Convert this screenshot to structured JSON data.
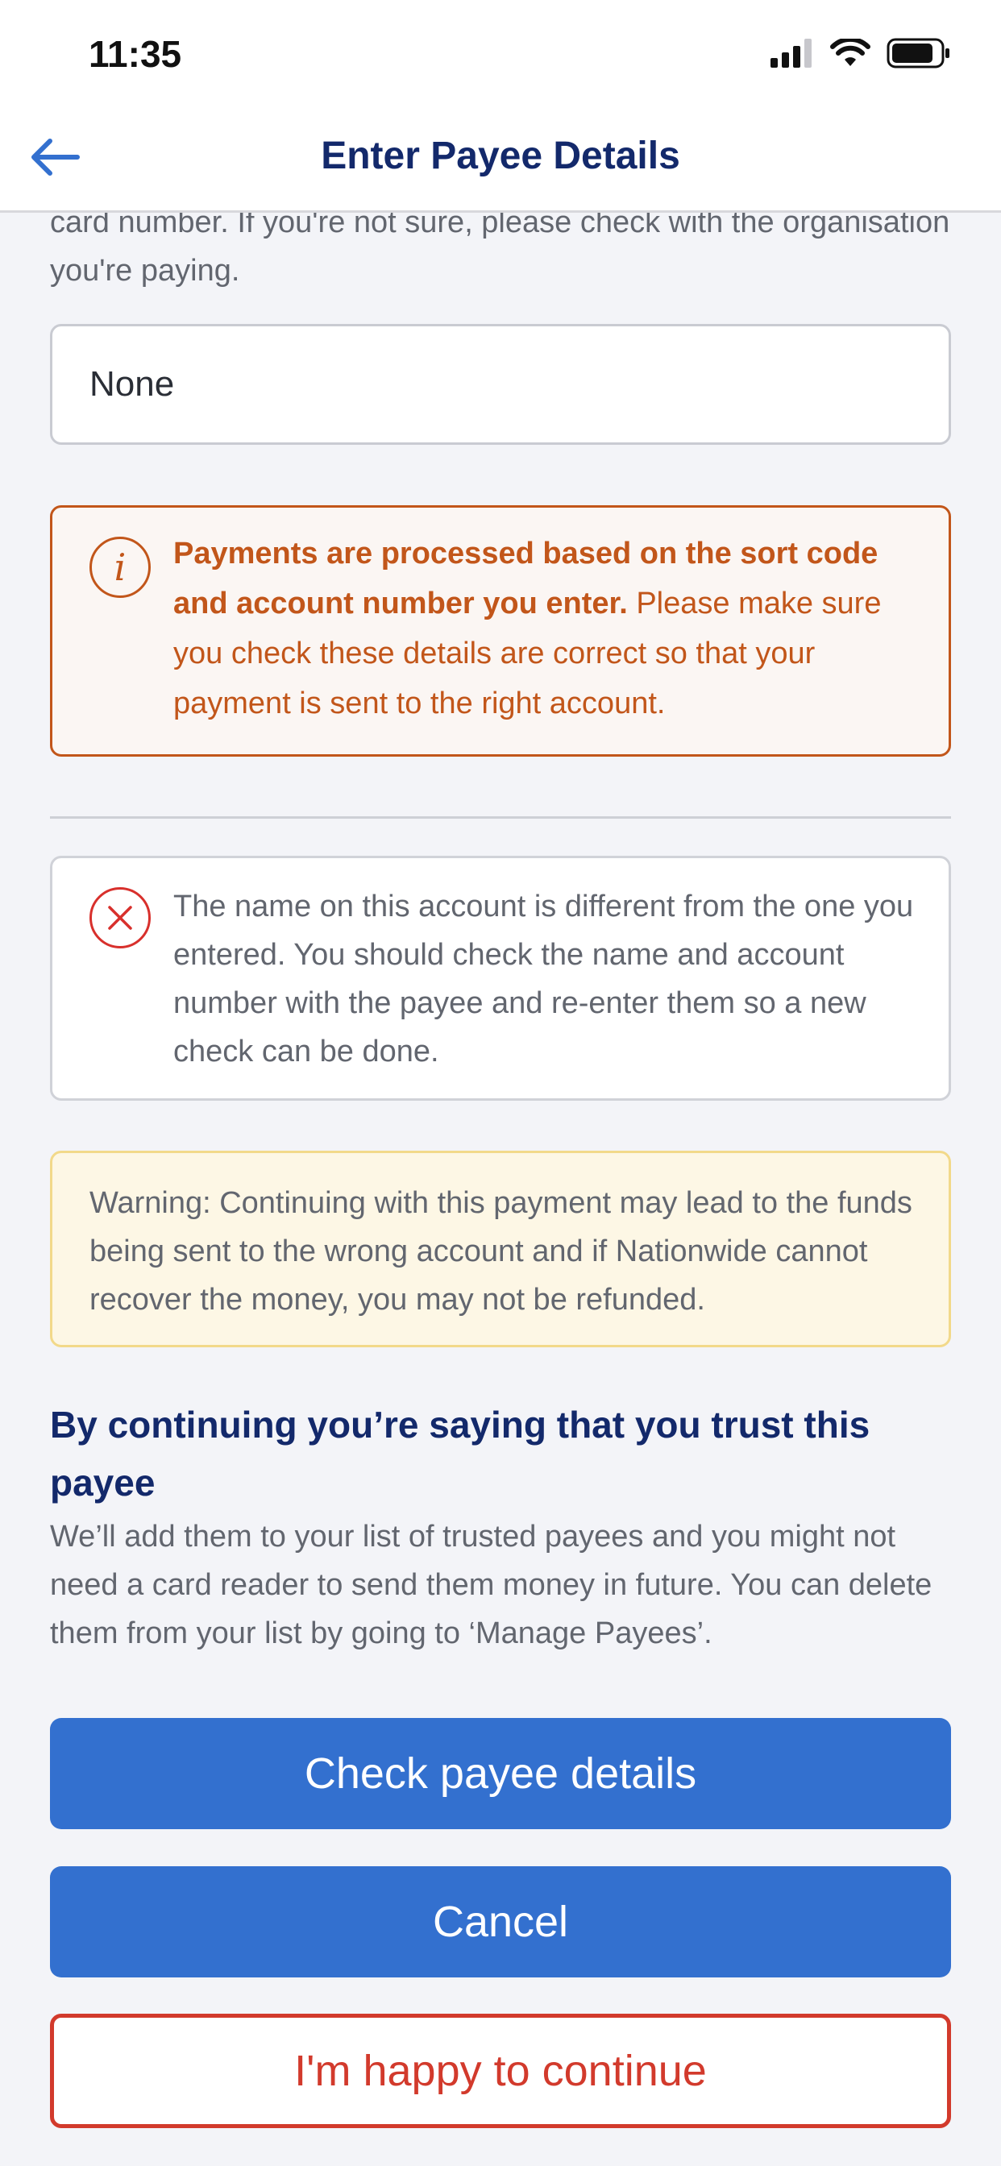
{
  "status_bar": {
    "time": "11:35"
  },
  "nav": {
    "title": "Enter Payee Details"
  },
  "intro_text": "card number. If you're not sure, please check with the organisation you're paying.",
  "reference_field": {
    "value": "None"
  },
  "info_notice": {
    "bold": "Payments are processed based on the sort code and account number you enter.",
    "text": " Please make sure you check these details are correct so that your payment is sent to the right account."
  },
  "name_check_error": {
    "text": "The name on this account is different from the one you entered. You should check the name and account number with the payee and re-enter them so a new check can be done."
  },
  "warning": {
    "text": "Warning: Continuing with this payment may lead to the funds being sent to the wrong account and if Nationwide cannot recover the money, you may not be refunded."
  },
  "trust": {
    "heading": "By continuing you’re saying that you trust this payee",
    "body": "We’ll add them to your list of trusted payees and you might not need a card reader to send them money in future. You can delete them from your list by going to ‘Manage Payees’."
  },
  "buttons": {
    "check": "Check payee details",
    "cancel": "Cancel",
    "continue": "I'm happy to continue"
  },
  "colors": {
    "primary": "#3370cf",
    "heading": "#13296b",
    "info": "#c2561a",
    "error": "#d8302c",
    "danger": "#d23a2c"
  }
}
